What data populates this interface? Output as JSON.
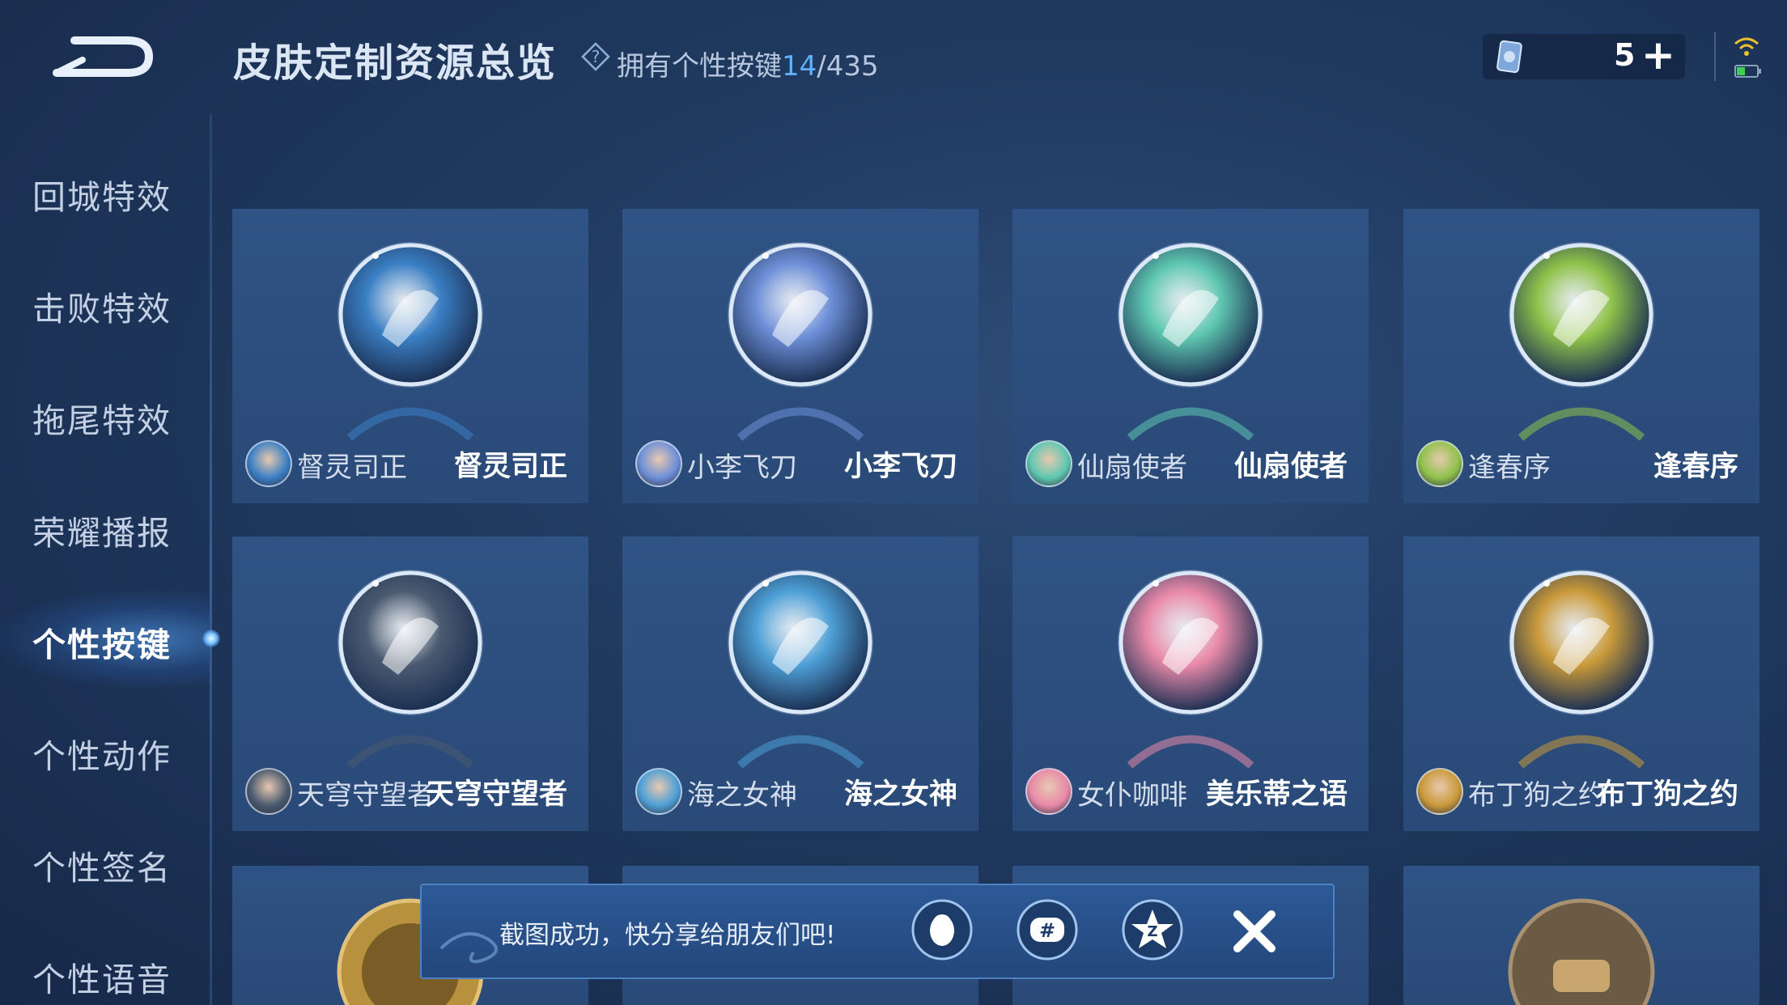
{
  "header": {
    "title": "皮肤定制资源总览",
    "owned_prefix": "拥有个性按键",
    "owned_count": "14",
    "owned_total": "/435",
    "currency_amount": "5"
  },
  "sidebar": {
    "items": [
      {
        "label": "回城特效"
      },
      {
        "label": "击败特效"
      },
      {
        "label": "拖尾特效"
      },
      {
        "label": "荣耀播报"
      },
      {
        "label": "个性按键"
      },
      {
        "label": "个性动作"
      },
      {
        "label": "个性签名"
      },
      {
        "label": "个性语音"
      }
    ],
    "active_label": "个性按键"
  },
  "cards": [
    {
      "hero": "督灵司正",
      "skin": "督灵司正",
      "icon": "blue-dragon-emblem-icon",
      "tint": "#3a7fc4"
    },
    {
      "hero": "小李飞刀",
      "skin": "小李飞刀",
      "icon": "pink-blade-emblem-icon",
      "tint": "#6d8fd8"
    },
    {
      "hero": "仙扇使者",
      "skin": "仙扇使者",
      "icon": "jade-fan-emblem-icon",
      "tint": "#5ec7b1"
    },
    {
      "hero": "逢春序",
      "skin": "逢春序",
      "icon": "green-leaf-emblem-icon",
      "tint": "#8fc24a"
    },
    {
      "hero": "天穹守望者",
      "skin": "天穹守望者",
      "icon": "golden-bow-emblem-icon",
      "tint": "#4a5a70"
    },
    {
      "hero": "海之女神",
      "skin": "海之女神",
      "icon": "sea-flower-emblem-icon",
      "tint": "#4d9fd6"
    },
    {
      "hero": "女仆咖啡",
      "skin": "美乐蒂之语",
      "icon": "my-melody-emblem-icon",
      "tint": "#e889a8"
    },
    {
      "hero": "布丁狗之约",
      "skin": "布丁狗之约",
      "icon": "pompompurin-emblem-icon",
      "tint": "#c99a3a"
    }
  ],
  "toast": {
    "message": "截图成功，快分享给朋友们吧!",
    "share_targets": [
      "qq-penguin-icon",
      "wechat-moments-icon",
      "qzone-star-icon"
    ]
  }
}
